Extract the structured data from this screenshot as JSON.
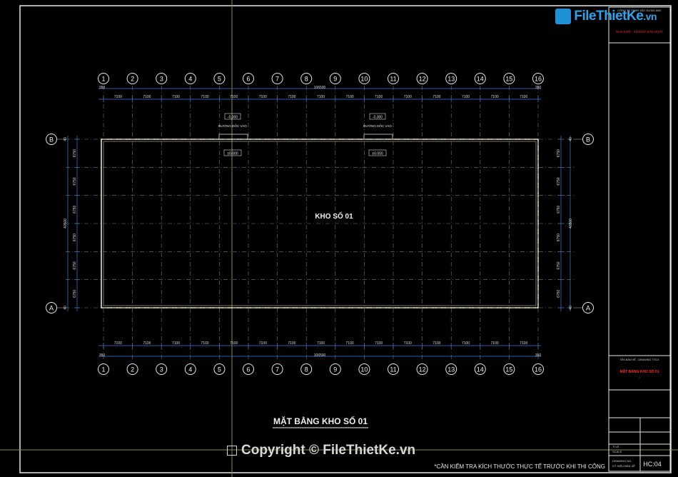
{
  "logo": {
    "name": "FileThietKe",
    "suffix": ".vn"
  },
  "watermark": {
    "text": "Copyright © FileThietKe.vn"
  },
  "plan": {
    "room_label": "KHO SỐ 01",
    "title": "MẶT BẰNG KHO SỐ 01",
    "note": "*CẦN KIỂM TRA KÍCH THƯỚC THỰC TẾ TRƯỚC KHI THI CÔNG",
    "grid_columns": [
      "1",
      "2",
      "3",
      "4",
      "5",
      "6",
      "7",
      "8",
      "9",
      "10",
      "11",
      "12",
      "13",
      "14",
      "15",
      "16"
    ],
    "grid_rows": [
      "B",
      "A"
    ],
    "bay_spacing": "7100",
    "overall_length": "106500",
    "end_offset": "350",
    "row_spacing": "6750",
    "overall_width": "40500",
    "edge_offset": "40",
    "ramps": [
      {
        "level": "-0,300",
        "label": "ĐƯỜNG DỐC VÀO",
        "floor_level": "±0.000"
      },
      {
        "level": "-0,300",
        "label": "ĐƯỜNG DỐC VÀO",
        "floor_level": "±0.000"
      }
    ]
  },
  "title_block": {
    "company_line1": "CÔNG TY TNHH XÂY DỰNG ABC",
    "company_line2": "NHÀ KHO - XƯỞNG SẢN XUẤT",
    "drawing_title_label": "TÊN BẢN VẼ - DRAWING TITLE",
    "drawing_title": "MẶT BẰNG KHO SỐ 01",
    "drawing_title_sub": "1",
    "scale_label_1": "TỈ LỆ",
    "scale_label_2": "SCALE",
    "number_label_1": "DRAWING NO.",
    "number_label_2": "KÝ HIỆU BẢN VẼ",
    "sheet_number": "HC:04"
  },
  "colors": {
    "background": "#000000",
    "frame": "#ffffff",
    "dimension": "#3a7bd5",
    "grid": "#9a9a9a",
    "wall": "#f2efc8",
    "title_red": "#ff2a2a",
    "logo_blue": "#2aa4ea"
  }
}
